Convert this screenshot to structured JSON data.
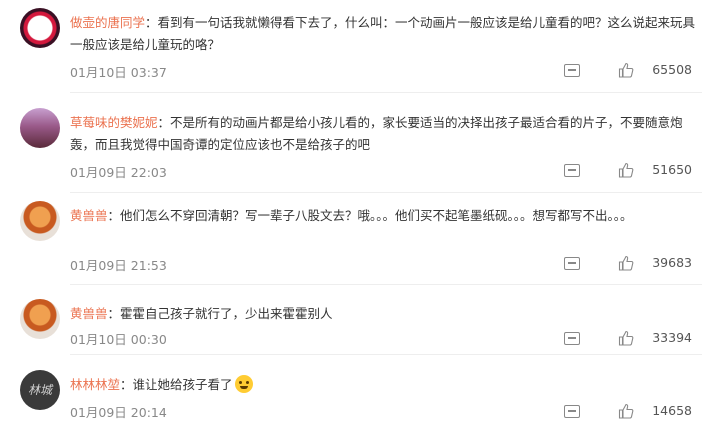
{
  "comments": [
    {
      "username": "做壶的唐同学",
      "separator": "：",
      "text": "看到有一句话我就懒得看下去了，什么叫：一个动画片一般应该是给儿童看的吧？这么说起来玩具一般应该是给儿童玩的咯？",
      "timestamp": "01月10日 03:37",
      "likes": "65508",
      "avatar_color": "#d4183d"
    },
    {
      "username": "草莓味的樊妮妮",
      "separator": "：",
      "text": "不是所有的动画片都是给小孩儿看的，家长要适当的决择出孩子最适合看的片子，不要随意炮轰，而且我觉得中国奇谭的定位应该也不是给孩子的吧",
      "timestamp": "01月09日 22:03",
      "likes": "51650",
      "avatar_color": "#9a5a8a"
    },
    {
      "username": "黄兽兽",
      "separator": "：",
      "text": "他们怎么不穿回清朝？写一辈子八股文去？哦。。。他们买不起笔墨纸砚。。。想写都写不出。。。",
      "timestamp": "01月09日 21:53",
      "likes": "39683",
      "avatar_color": "#c85a20"
    },
    {
      "username": "黄兽兽",
      "separator": "：",
      "text": "霍霍自己孩子就行了，少出来霍霍别人",
      "timestamp": "01月10日 00:30",
      "likes": "33394",
      "avatar_color": "#c85a20"
    },
    {
      "username": "林林林堃",
      "separator": "：",
      "text": "谁让她给孩子看了",
      "timestamp": "01月09日 20:14",
      "likes": "14658",
      "avatar_color": "#3a3a3a",
      "avatar_text": "林城",
      "emoji": "crying-face-icon"
    }
  ],
  "colors": {
    "username": "#eb7350",
    "text": "#333333",
    "meta": "#888888"
  }
}
